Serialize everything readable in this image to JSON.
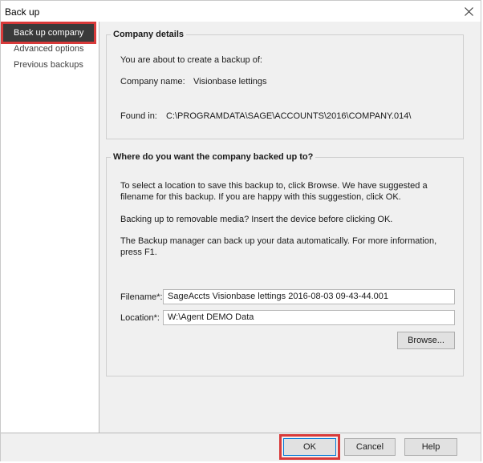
{
  "window": {
    "title": "Back up"
  },
  "sidebar": {
    "items": [
      {
        "label": "Back up company",
        "selected": true
      },
      {
        "label": "Advanced options",
        "selected": false
      },
      {
        "label": "Previous backups",
        "selected": false
      }
    ]
  },
  "company_details": {
    "heading": "Company details",
    "intro": "You are about to create a backup of:",
    "name_label": "Company name:",
    "name_value": "Visionbase lettings",
    "found_label": "Found in:",
    "found_value": "C:\\PROGRAMDATA\\SAGE\\ACCOUNTS\\2016\\COMPANY.014\\"
  },
  "destination": {
    "heading": "Where do you want the company backed up to?",
    "para1": "To select a location to save this backup to, click Browse. We have suggested a filename for this backup. If you are happy with this suggestion, click OK.",
    "para2": "Backing up to removable media?  Insert the device before clicking OK.",
    "para3": "The Backup manager can back up your data automatically. For more information, press F1.",
    "filename_label": "Filename*:",
    "filename_value": "SageAccts Visionbase lettings 2016-08-03 09-43-44.001",
    "location_label": "Location*:",
    "location_value": "W:\\Agent DEMO Data",
    "browse_label": "Browse..."
  },
  "footer": {
    "ok_label": "OK",
    "cancel_label": "Cancel",
    "help_label": "Help"
  },
  "colors": {
    "highlight_border": "#d83a3a",
    "selected_bg": "#3a3a3a",
    "panel_bg": "#f0f0f0"
  }
}
